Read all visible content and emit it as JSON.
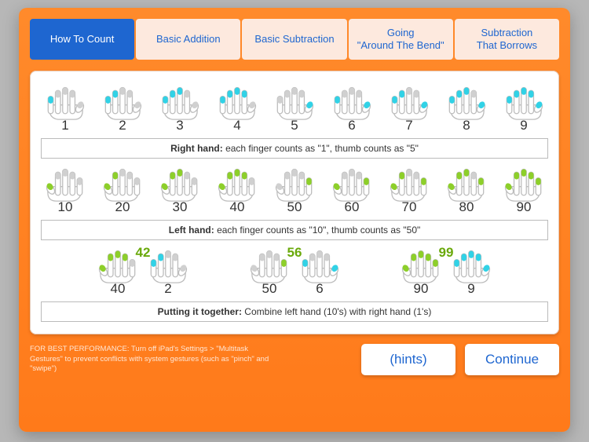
{
  "tabs": [
    {
      "label": "How To Count",
      "active": true
    },
    {
      "label": "Basic Addition",
      "active": false
    },
    {
      "label": "Basic Subtraction",
      "active": false
    },
    {
      "label": "Going\n\"Around The Bend\"",
      "active": false
    },
    {
      "label": "Subtraction\nThat Borrows",
      "active": false
    }
  ],
  "row1": {
    "color": "cyan",
    "items": [
      {
        "num": "1",
        "tips": [
          1,
          0,
          0,
          0,
          0
        ]
      },
      {
        "num": "2",
        "tips": [
          1,
          1,
          0,
          0,
          0
        ]
      },
      {
        "num": "3",
        "tips": [
          1,
          1,
          1,
          0,
          0
        ]
      },
      {
        "num": "4",
        "tips": [
          1,
          1,
          1,
          1,
          0
        ]
      },
      {
        "num": "5",
        "tips": [
          0,
          0,
          0,
          0,
          1
        ]
      },
      {
        "num": "6",
        "tips": [
          1,
          0,
          0,
          0,
          1
        ]
      },
      {
        "num": "7",
        "tips": [
          1,
          1,
          0,
          0,
          1
        ]
      },
      {
        "num": "8",
        "tips": [
          1,
          1,
          1,
          0,
          1
        ]
      },
      {
        "num": "9",
        "tips": [
          1,
          1,
          1,
          1,
          1
        ]
      }
    ],
    "rule_bold": "Right hand:",
    "rule_rest": " each finger counts as \"1\", thumb counts as \"5\""
  },
  "row2": {
    "color": "green",
    "items": [
      {
        "num": "10",
        "tips": [
          0,
          0,
          0,
          0,
          1
        ]
      },
      {
        "num": "20",
        "tips": [
          0,
          0,
          0,
          1,
          1
        ]
      },
      {
        "num": "30",
        "tips": [
          0,
          0,
          1,
          1,
          1
        ]
      },
      {
        "num": "40",
        "tips": [
          0,
          1,
          1,
          1,
          1
        ]
      },
      {
        "num": "50",
        "tips": [
          1,
          0,
          0,
          0,
          0
        ]
      },
      {
        "num": "60",
        "tips": [
          1,
          0,
          0,
          0,
          1
        ]
      },
      {
        "num": "70",
        "tips": [
          1,
          0,
          0,
          1,
          1
        ]
      },
      {
        "num": "80",
        "tips": [
          1,
          0,
          1,
          1,
          1
        ]
      },
      {
        "num": "90",
        "tips": [
          1,
          1,
          1,
          1,
          1
        ]
      }
    ],
    "rule_bold": "Left hand:",
    "rule_rest": " each finger counts as \"10\", thumb counts as \"50\""
  },
  "row3": {
    "combos": [
      {
        "sum": "42",
        "left": {
          "color": "green",
          "num": "40",
          "tips": [
            0,
            1,
            1,
            1,
            1
          ],
          "mirror": true
        },
        "right": {
          "color": "cyan",
          "num": "2",
          "tips": [
            1,
            1,
            0,
            0,
            0
          ],
          "mirror": false
        }
      },
      {
        "sum": "56",
        "left": {
          "color": "green",
          "num": "50",
          "tips": [
            1,
            0,
            0,
            0,
            0
          ],
          "mirror": true
        },
        "right": {
          "color": "cyan",
          "num": "6",
          "tips": [
            1,
            0,
            0,
            0,
            1
          ],
          "mirror": false
        }
      },
      {
        "sum": "99",
        "left": {
          "color": "green",
          "num": "90",
          "tips": [
            1,
            1,
            1,
            1,
            1
          ],
          "mirror": true
        },
        "right": {
          "color": "cyan",
          "num": "9",
          "tips": [
            1,
            1,
            1,
            1,
            1
          ],
          "mirror": false
        }
      }
    ],
    "rule_bold": "Putting it together:",
    "rule_rest": " Combine left hand (10's) with right hand (1's)"
  },
  "footer": {
    "note": "FOR BEST PERFORMANCE: Turn off iPad's Settings > \"Multitask Gestures\" to prevent conflicts with system gestures (such as \"pinch\" and \"swipe\")",
    "hints": "(hints)",
    "continue": "Continue"
  }
}
